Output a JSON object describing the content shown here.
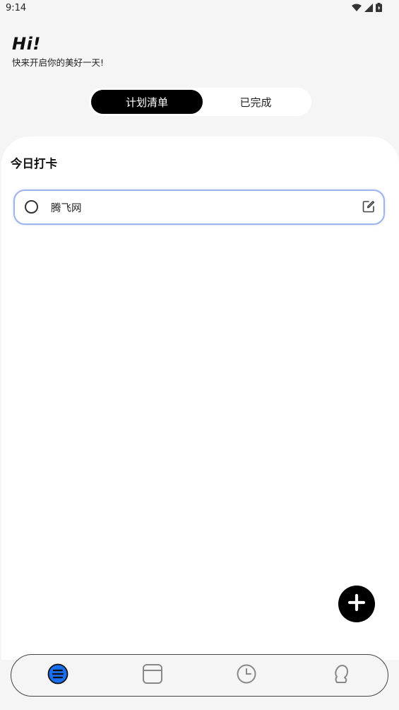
{
  "status_bar": {
    "time": "9:14",
    "icons": [
      "wifi-icon",
      "signal-icon",
      "battery-icon"
    ]
  },
  "header": {
    "hi": "Hi!",
    "greeting": "快来开启你的美好一天!"
  },
  "tabs": [
    {
      "label": "计划清单",
      "active": true
    },
    {
      "label": "已完成",
      "active": false
    }
  ],
  "section": {
    "title": "今日打卡"
  },
  "tasks": [
    {
      "label": "腾飞网",
      "done": false
    }
  ],
  "bottom_nav": [
    {
      "icon": "list-icon",
      "active": true
    },
    {
      "icon": "calendar-icon",
      "active": false
    },
    {
      "icon": "clock-icon",
      "active": false
    },
    {
      "icon": "profile-icon",
      "active": false
    }
  ],
  "colors": {
    "accent": "#1a6ef0",
    "background": "#f5f5f5",
    "card_border": "#9db5ea"
  }
}
